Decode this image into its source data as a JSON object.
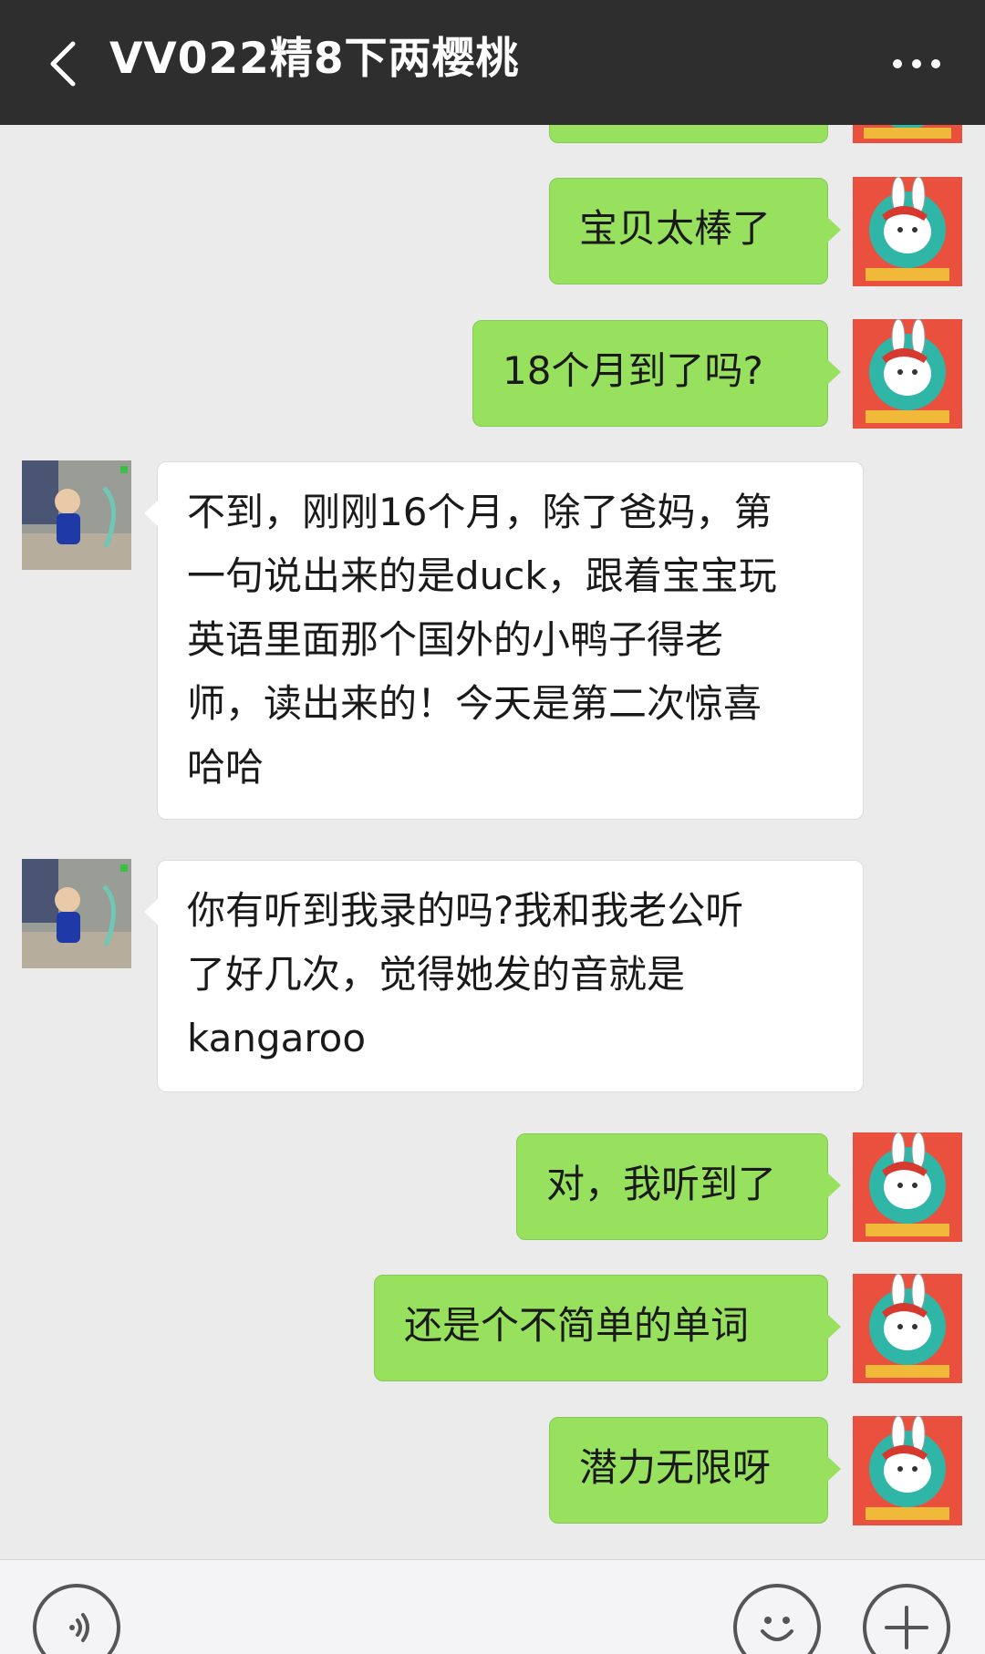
{
  "header": {
    "title": "VV022精8下两樱桃",
    "back_icon": "chevron-left-icon",
    "more_icon": "more-dots-icon"
  },
  "messages": [
    {
      "side": "sent",
      "text": ""
    },
    {
      "side": "sent",
      "text": "宝贝太棒了"
    },
    {
      "side": "sent",
      "text": "18个月到了吗?"
    },
    {
      "side": "received",
      "text": "不到，刚刚16个月，除了爸妈，第\n一句说出来的是duck，跟着宝宝玩\n英语里面那个国外的小鸭子得老\n师，读出来的！今天是第二次惊喜\n哈哈"
    },
    {
      "side": "received",
      "text": "你有听到我录的吗?我和我老公听\n了好几次，觉得她发的音就是\nkangaroo"
    },
    {
      "side": "sent",
      "text": "对，我听到了"
    },
    {
      "side": "sent",
      "text": "还是个不简单的单词"
    },
    {
      "side": "sent",
      "text": "潜力无限呀"
    }
  ],
  "bottom_bar": {
    "voice_icon": "voice-icon",
    "emoji_icon": "emoji-icon",
    "add_icon": "plus-icon"
  },
  "colors": {
    "header_bg": "#2e2e2e",
    "chat_bg": "#ebebeb",
    "sent_bubble": "#97e15f",
    "received_bubble": "#ffffff",
    "self_avatar": "#e9503e"
  }
}
